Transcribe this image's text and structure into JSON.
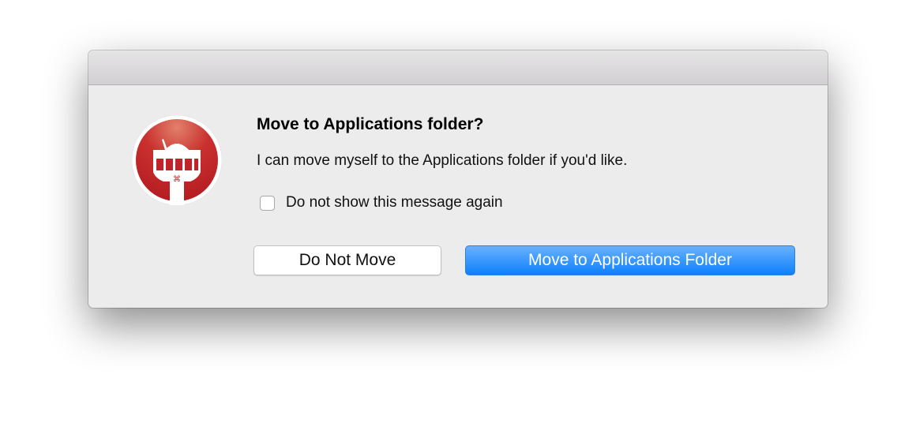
{
  "dialog": {
    "title": "Move to Applications folder?",
    "message": "I can move myself to the Applications folder if you'd like.",
    "checkbox": {
      "label": "Do not show this message again",
      "checked": false
    },
    "buttons": {
      "secondary": "Do Not Move",
      "primary": "Move to Applications Folder"
    },
    "app_icon": "control-tower-icon",
    "colors": {
      "primary_button": "#1a85fd",
      "icon_red": "#c0242a"
    }
  }
}
